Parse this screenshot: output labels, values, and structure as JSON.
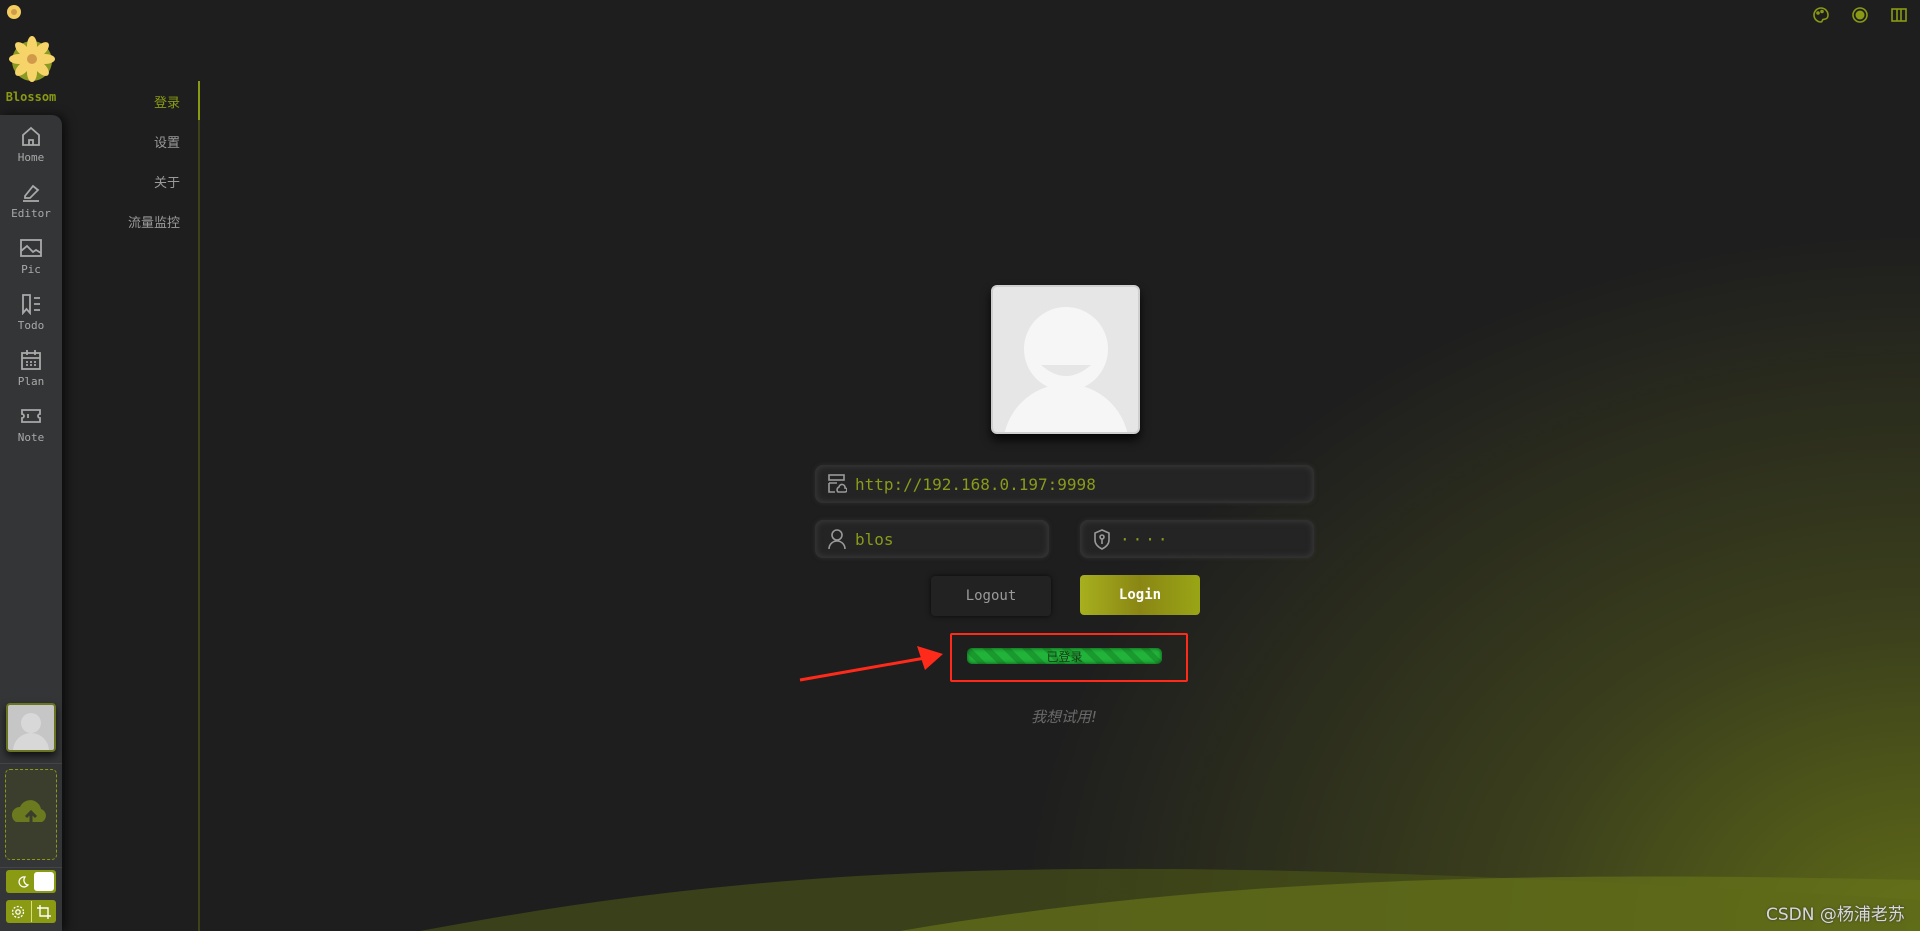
{
  "app": {
    "name": "Blossom"
  },
  "colors": {
    "accent": "#8a9a12",
    "status_green": "#22b33a",
    "annotation_red": "#ff2a1a"
  },
  "header": {
    "icons": [
      "palette-icon",
      "record-icon",
      "columns-icon"
    ]
  },
  "sidebar": {
    "items": [
      {
        "label": "Home",
        "icon": "home-icon"
      },
      {
        "label": "Editor",
        "icon": "highlighter-icon"
      },
      {
        "label": "Pic",
        "icon": "image-icon"
      },
      {
        "label": "Todo",
        "icon": "bookmark-list-icon"
      },
      {
        "label": "Plan",
        "icon": "calendar-icon"
      },
      {
        "label": "Note",
        "icon": "ticket-icon"
      }
    ]
  },
  "submenu": {
    "items": [
      {
        "label": "登录",
        "active": true
      },
      {
        "label": "设置"
      },
      {
        "label": "关于"
      },
      {
        "label": "流量监控"
      }
    ]
  },
  "login": {
    "server_url": "http://192.168.0.197:9998",
    "username": "blos",
    "password_mask": "····",
    "logout_label": "Logout",
    "login_label": "Login",
    "status_text": "已登录",
    "trial_link": "我想试用!"
  },
  "watermark": "CSDN @杨浦老苏"
}
